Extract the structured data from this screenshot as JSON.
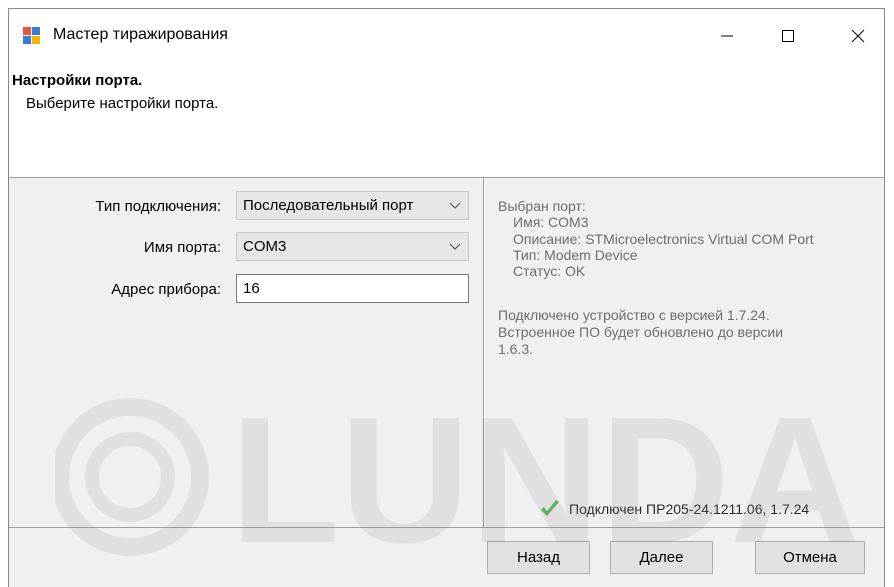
{
  "window": {
    "title": "Мастер тиражирования"
  },
  "header": {
    "title": "Настройки порта.",
    "subtitle": "Выберите настройки порта."
  },
  "form": {
    "connection_type": {
      "label": "Тип подключения:",
      "value": "Последовательный порт"
    },
    "port_name": {
      "label": "Имя порта:",
      "value": "COM3"
    },
    "device_address": {
      "label": "Адрес прибора:",
      "value": "16"
    }
  },
  "info": {
    "heading": "Выбран порт:",
    "name": "Имя: COM3",
    "description": "Описание: STMicroelectronics Virtual COM Port",
    "type": "Тип: Modem Device",
    "status": "Статус: OK",
    "line1": "Подключено устройство с версией 1.7.24.",
    "line2": "Встроенное ПО будет обновлено до версии",
    "line3": "1.6.3.",
    "connected": "Подключен ПР205-24.1211.06, 1.7.24"
  },
  "footer": {
    "back_label": "Назад",
    "next_label": "Далее",
    "cancel_label": "Отмена"
  },
  "watermark": {
    "text": "LUNDA"
  },
  "colors": {
    "accent_green": "#5cb85c",
    "info_text": "#6d6d6d"
  }
}
